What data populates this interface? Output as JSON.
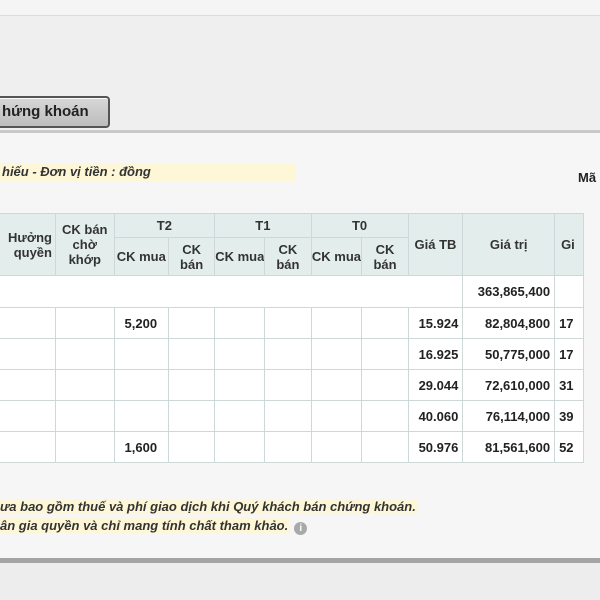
{
  "tab": {
    "label": "hứng khoán"
  },
  "unit_note": "hiếu - Đơn vị tiền : đồng",
  "right_label": "Mã",
  "table": {
    "headers": {
      "rights": "Hưởng quyền",
      "ck_pending_sell": "CK bán chờ khớp",
      "t2": "T2",
      "t1": "T1",
      "t0": "T0",
      "ck_buy": "CK mua",
      "ck_sell": "CK bán",
      "avg_price": "Giá TB",
      "value": "Giá trị",
      "next": "Gi"
    },
    "total_value": "363,865,400",
    "rows": [
      {
        "t2_buy": "5,200",
        "avg_price": "15.924",
        "value": "82,804,800",
        "next": "17"
      },
      {
        "t2_buy": "",
        "avg_price": "16.925",
        "value": "50,775,000",
        "next": "17"
      },
      {
        "t2_buy": "",
        "avg_price": "29.044",
        "value": "72,610,000",
        "next": "31"
      },
      {
        "t2_buy": "",
        "avg_price": "40.060",
        "value": "76,114,000",
        "next": "39"
      },
      {
        "t2_buy": "1,600",
        "avg_price": "50.976",
        "value": "81,561,600",
        "next": "52"
      }
    ]
  },
  "footnotes": [
    "ưa bao gồm thuế và phí giao dịch khi Quý khách bán chứng khoán.",
    "ân gia quyền và chỉ mang tính chất tham khảo."
  ],
  "icons": {
    "info": "info-icon"
  }
}
